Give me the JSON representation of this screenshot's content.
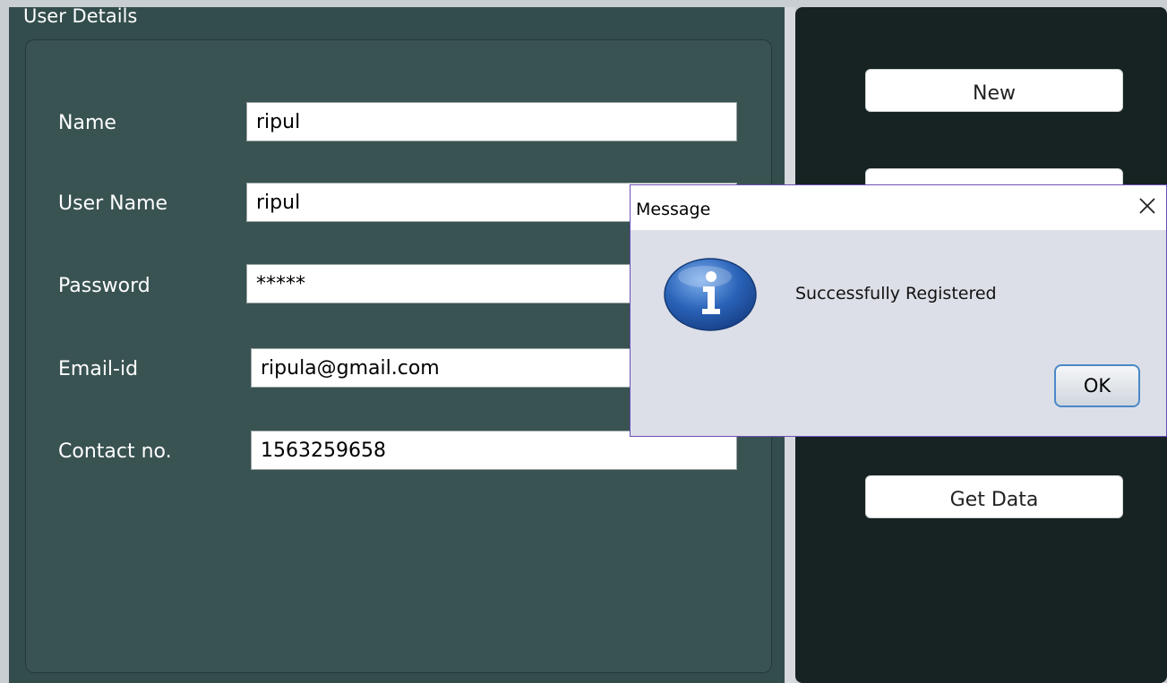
{
  "form": {
    "group_title": "User Details",
    "fields": [
      {
        "label": "Name",
        "value": "ripul"
      },
      {
        "label": "User Name",
        "value": "ripul"
      },
      {
        "label": "Password",
        "value": "*****"
      },
      {
        "label": "Email-id",
        "value": "ripula@gmail.com"
      },
      {
        "label": "Contact no.",
        "value": "1563259658"
      }
    ]
  },
  "actions": {
    "new_label": "New",
    "hidden_label": "",
    "get_data_label": "Get Data"
  },
  "dialog": {
    "title": "Message",
    "message": "Successfully Registered",
    "ok_label": "OK",
    "icon": "info-icon",
    "icon_color": "#2a63b8"
  },
  "colors": {
    "panel_bg": "#334d4d",
    "right_panel_bg": "#172222",
    "dialog_border": "#6b4fb8"
  }
}
